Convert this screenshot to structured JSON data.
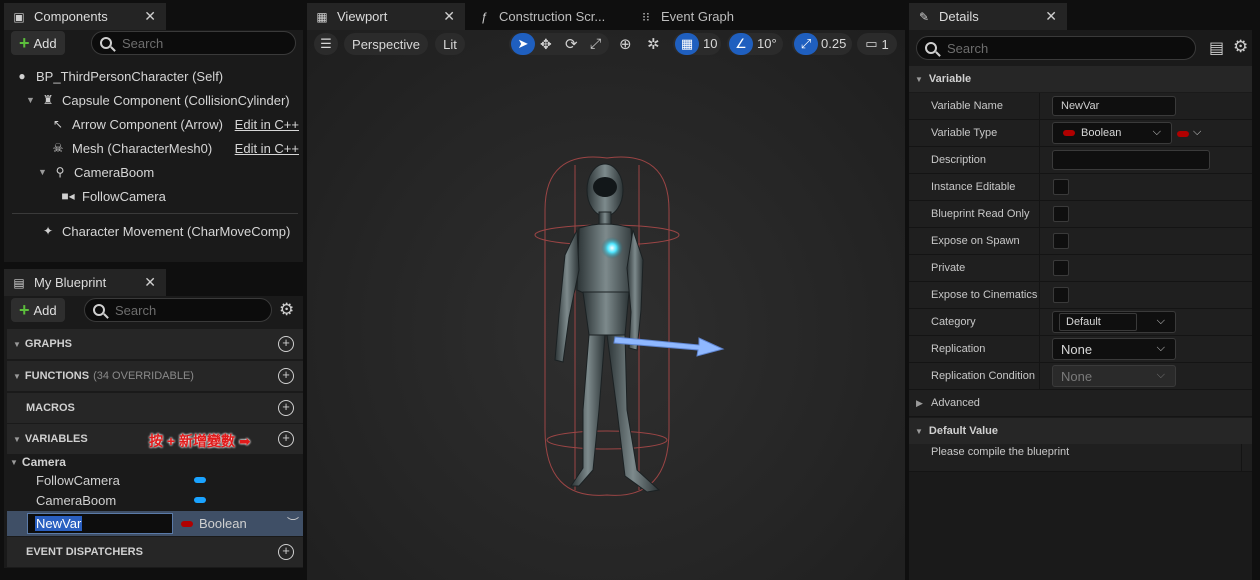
{
  "components_panel": {
    "tab_title": "Components",
    "add_label": "Add",
    "search_placeholder": "Search",
    "tree": [
      {
        "label": "BP_ThirdPersonCharacter (Self)",
        "icon": "person-icon"
      },
      {
        "label": "Capsule Component (CollisionCylinder)",
        "icon": "capsule-icon"
      },
      {
        "label": "Arrow Component (Arrow)",
        "icon": "arrow-icon",
        "edit": "Edit in C++"
      },
      {
        "label": "Mesh (CharacterMesh0)",
        "icon": "skeleton-icon",
        "edit": "Edit in C++"
      },
      {
        "label": "CameraBoom",
        "icon": "boom-icon"
      },
      {
        "label": "FollowCamera",
        "icon": "camera-icon"
      },
      {
        "label": "Character Movement (CharMoveComp)",
        "icon": "movement-icon"
      }
    ]
  },
  "blueprint_panel": {
    "tab_title": "My Blueprint",
    "add_label": "Add",
    "search_placeholder": "Search",
    "sections": {
      "graphs": "GRAPHS",
      "functions": "FUNCTIONS",
      "functions_note": "(34 OVERRIDABLE)",
      "macros": "MACROS",
      "variables": "VARIABLES",
      "variables_annotation": "按 + 新增變數 ➡",
      "event_dispatchers": "EVENT DISPATCHERS"
    },
    "category": "Camera",
    "variables": [
      {
        "name": "FollowCamera",
        "color": "#1aa3ff"
      },
      {
        "name": "CameraBoom",
        "color": "#1aa3ff"
      }
    ],
    "new_var": {
      "name": "NewVar",
      "type": "Boolean",
      "color": "#b00000"
    }
  },
  "viewport": {
    "tabs": [
      "Viewport",
      "Construction Scr...",
      "Event Graph"
    ],
    "perspective_label": "Perspective",
    "lit_label": "Lit",
    "grid_value": "10",
    "angle_value": "10°",
    "scale_value": "0.25",
    "camera_speed": "1"
  },
  "details_panel": {
    "tab_title": "Details",
    "search_placeholder": "Search",
    "variable_header": "Variable",
    "rows": {
      "variable_name_label": "Variable Name",
      "variable_name_value": "NewVar",
      "variable_type_label": "Variable Type",
      "variable_type_value": "Boolean",
      "description_label": "Description",
      "instance_editable_label": "Instance Editable",
      "blueprint_read_only_label": "Blueprint Read Only",
      "expose_on_spawn_label": "Expose on Spawn",
      "private_label": "Private",
      "expose_to_cinematics_label": "Expose to Cinematics",
      "category_label": "Category",
      "category_value": "Default",
      "replication_label": "Replication",
      "replication_value": "None",
      "replication_condition_label": "Replication Condition",
      "replication_condition_value": "None",
      "advanced_label": "Advanced"
    },
    "default_value_header": "Default Value",
    "compile_note": "Please compile the blueprint"
  },
  "colors": {
    "accent_blue": "#1f5fbf",
    "bool_red": "#b00000",
    "object_blue": "#1aa3ff",
    "annotation_red": "#e11b1b"
  }
}
